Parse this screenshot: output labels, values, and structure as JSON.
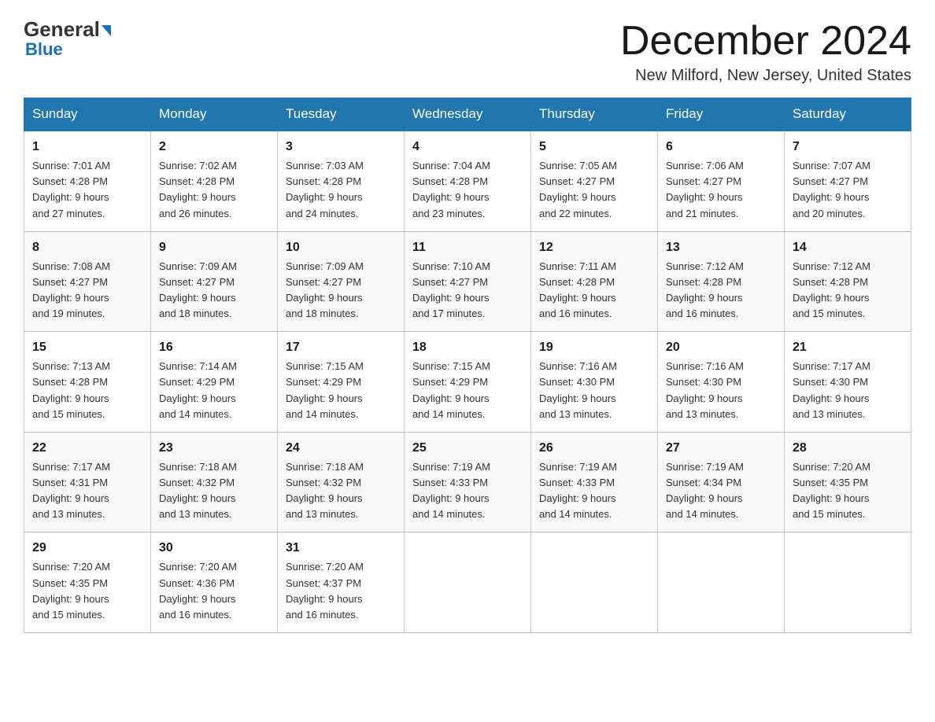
{
  "header": {
    "logo_general": "General",
    "logo_blue": "Blue",
    "month_title": "December 2024",
    "location": "New Milford, New Jersey, United States"
  },
  "columns": [
    "Sunday",
    "Monday",
    "Tuesday",
    "Wednesday",
    "Thursday",
    "Friday",
    "Saturday"
  ],
  "weeks": [
    [
      {
        "day": "1",
        "sunrise": "7:01 AM",
        "sunset": "4:28 PM",
        "daylight": "9 hours and 27 minutes."
      },
      {
        "day": "2",
        "sunrise": "7:02 AM",
        "sunset": "4:28 PM",
        "daylight": "9 hours and 26 minutes."
      },
      {
        "day": "3",
        "sunrise": "7:03 AM",
        "sunset": "4:28 PM",
        "daylight": "9 hours and 24 minutes."
      },
      {
        "day": "4",
        "sunrise": "7:04 AM",
        "sunset": "4:28 PM",
        "daylight": "9 hours and 23 minutes."
      },
      {
        "day": "5",
        "sunrise": "7:05 AM",
        "sunset": "4:27 PM",
        "daylight": "9 hours and 22 minutes."
      },
      {
        "day": "6",
        "sunrise": "7:06 AM",
        "sunset": "4:27 PM",
        "daylight": "9 hours and 21 minutes."
      },
      {
        "day": "7",
        "sunrise": "7:07 AM",
        "sunset": "4:27 PM",
        "daylight": "9 hours and 20 minutes."
      }
    ],
    [
      {
        "day": "8",
        "sunrise": "7:08 AM",
        "sunset": "4:27 PM",
        "daylight": "9 hours and 19 minutes."
      },
      {
        "day": "9",
        "sunrise": "7:09 AM",
        "sunset": "4:27 PM",
        "daylight": "9 hours and 18 minutes."
      },
      {
        "day": "10",
        "sunrise": "7:09 AM",
        "sunset": "4:27 PM",
        "daylight": "9 hours and 18 minutes."
      },
      {
        "day": "11",
        "sunrise": "7:10 AM",
        "sunset": "4:27 PM",
        "daylight": "9 hours and 17 minutes."
      },
      {
        "day": "12",
        "sunrise": "7:11 AM",
        "sunset": "4:28 PM",
        "daylight": "9 hours and 16 minutes."
      },
      {
        "day": "13",
        "sunrise": "7:12 AM",
        "sunset": "4:28 PM",
        "daylight": "9 hours and 16 minutes."
      },
      {
        "day": "14",
        "sunrise": "7:12 AM",
        "sunset": "4:28 PM",
        "daylight": "9 hours and 15 minutes."
      }
    ],
    [
      {
        "day": "15",
        "sunrise": "7:13 AM",
        "sunset": "4:28 PM",
        "daylight": "9 hours and 15 minutes."
      },
      {
        "day": "16",
        "sunrise": "7:14 AM",
        "sunset": "4:29 PM",
        "daylight": "9 hours and 14 minutes."
      },
      {
        "day": "17",
        "sunrise": "7:15 AM",
        "sunset": "4:29 PM",
        "daylight": "9 hours and 14 minutes."
      },
      {
        "day": "18",
        "sunrise": "7:15 AM",
        "sunset": "4:29 PM",
        "daylight": "9 hours and 14 minutes."
      },
      {
        "day": "19",
        "sunrise": "7:16 AM",
        "sunset": "4:30 PM",
        "daylight": "9 hours and 13 minutes."
      },
      {
        "day": "20",
        "sunrise": "7:16 AM",
        "sunset": "4:30 PM",
        "daylight": "9 hours and 13 minutes."
      },
      {
        "day": "21",
        "sunrise": "7:17 AM",
        "sunset": "4:30 PM",
        "daylight": "9 hours and 13 minutes."
      }
    ],
    [
      {
        "day": "22",
        "sunrise": "7:17 AM",
        "sunset": "4:31 PM",
        "daylight": "9 hours and 13 minutes."
      },
      {
        "day": "23",
        "sunrise": "7:18 AM",
        "sunset": "4:32 PM",
        "daylight": "9 hours and 13 minutes."
      },
      {
        "day": "24",
        "sunrise": "7:18 AM",
        "sunset": "4:32 PM",
        "daylight": "9 hours and 13 minutes."
      },
      {
        "day": "25",
        "sunrise": "7:19 AM",
        "sunset": "4:33 PM",
        "daylight": "9 hours and 14 minutes."
      },
      {
        "day": "26",
        "sunrise": "7:19 AM",
        "sunset": "4:33 PM",
        "daylight": "9 hours and 14 minutes."
      },
      {
        "day": "27",
        "sunrise": "7:19 AM",
        "sunset": "4:34 PM",
        "daylight": "9 hours and 14 minutes."
      },
      {
        "day": "28",
        "sunrise": "7:20 AM",
        "sunset": "4:35 PM",
        "daylight": "9 hours and 15 minutes."
      }
    ],
    [
      {
        "day": "29",
        "sunrise": "7:20 AM",
        "sunset": "4:35 PM",
        "daylight": "9 hours and 15 minutes."
      },
      {
        "day": "30",
        "sunrise": "7:20 AM",
        "sunset": "4:36 PM",
        "daylight": "9 hours and 16 minutes."
      },
      {
        "day": "31",
        "sunrise": "7:20 AM",
        "sunset": "4:37 PM",
        "daylight": "9 hours and 16 minutes."
      },
      null,
      null,
      null,
      null
    ]
  ],
  "labels": {
    "sunrise": "Sunrise:",
    "sunset": "Sunset:",
    "daylight": "Daylight:"
  }
}
